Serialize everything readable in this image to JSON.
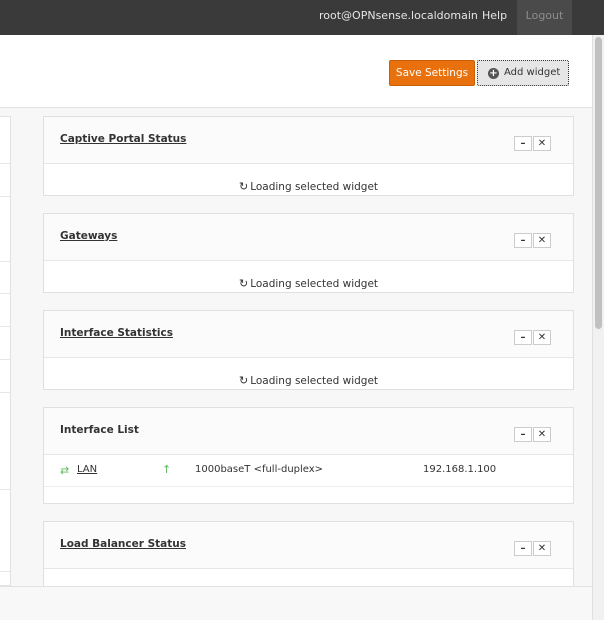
{
  "topnav": {
    "user": "root@OPNsense.localdomain",
    "help": "Help",
    "logout": "Logout"
  },
  "header": {
    "save_label": "Save Settings",
    "add_label": "Add widget"
  },
  "widgets": [
    {
      "title": "Captive Portal Status",
      "loading": "Loading selected widget"
    },
    {
      "title": "Gateways",
      "loading": "Loading selected widget"
    },
    {
      "title": "Interface Statistics",
      "loading": "Loading selected widget"
    },
    {
      "title": "Interface List"
    },
    {
      "title": "Load Balancer Status"
    }
  ],
  "interfaces": [
    {
      "name": "LAN",
      "media": "1000baseT <full-duplex>",
      "ip": "192.168.1.100"
    }
  ],
  "controls": {
    "minimize": "–",
    "close": "✕"
  },
  "icons": {
    "refresh": "↻",
    "transfer": "⇄",
    "arrow_up": "↑",
    "plus": "+"
  },
  "colors": {
    "accent": "#e8710d",
    "nav_bg": "#3a3a3a",
    "status_up": "#5cb85c"
  }
}
